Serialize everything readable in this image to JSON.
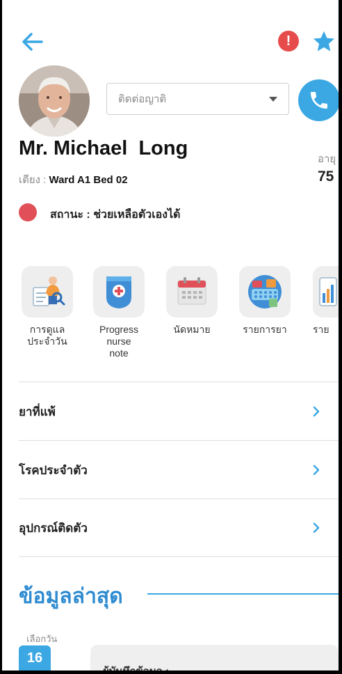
{
  "header": {
    "back_icon": "arrow-left-icon",
    "alert_icon": "exclamation-circle-icon",
    "alert_glyph": "!",
    "favorite_icon": "star-icon",
    "accent_color": "#3ba7e3",
    "alert_color": "#e74c4c"
  },
  "patient": {
    "contact_placeholder": "ติดต่อญาติ",
    "call_icon": "phone-icon",
    "name": "Mr. Michael  Long",
    "age_label": "อายุ",
    "age_value": "75",
    "bed_label": "เตียง : ",
    "bed_value": "Ward A1 Bed 02",
    "status_label": "สถานะ : ช่วยเหลือตัวเองได้",
    "status_color": "#e14f58"
  },
  "menu": [
    {
      "label": "การดูแล\nประจำวัน",
      "icon": "daily-care-icon"
    },
    {
      "label": "Progress\nnurse\nnote",
      "icon": "nurse-note-icon"
    },
    {
      "label": "นัดหมาย",
      "icon": "calendar-icon"
    },
    {
      "label": "รายการยา",
      "icon": "medication-icon"
    },
    {
      "label": "ราย",
      "icon": "report-icon"
    }
  ],
  "list": [
    {
      "label": "ยาที่แพ้",
      "icon": "chevron-right-icon"
    },
    {
      "label": "โรคประจำตัว",
      "icon": "chevron-right-icon"
    },
    {
      "label": "อุปกรณ์ติดตัว",
      "icon": "chevron-right-icon"
    }
  ],
  "latest": {
    "title": "ข้อมูลล่าสุด",
    "date_label": "เลือกวัน",
    "date_value": "16",
    "record_label": "ผู้บันทึกข้อมูล :"
  }
}
